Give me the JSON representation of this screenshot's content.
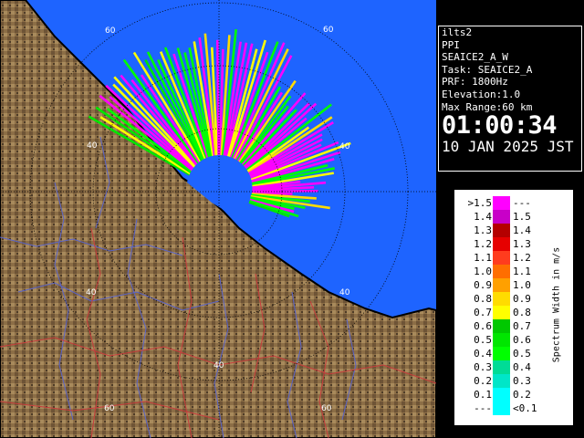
{
  "info": {
    "radar": "ilts2",
    "scan_type": "PPI",
    "product": "SEAICE2_A_W",
    "task": "Task: SEAICE2_A",
    "prf": "PRF: 1800Hz",
    "elevation": "Elevation:1.0",
    "max_range": "Max Range:60 km",
    "time": "01:00:34",
    "date": "10 JAN 2025 JST"
  },
  "legend": {
    "title": "Spectrum Width in m/s",
    "rows": [
      {
        "lo": ">1.5",
        "hi": "---",
        "color": "#ff00ff"
      },
      {
        "lo": "1.4",
        "hi": "1.5",
        "color": "#c800c8"
      },
      {
        "lo": "1.3",
        "hi": "1.4",
        "color": "#b40000"
      },
      {
        "lo": "1.2",
        "hi": "1.3",
        "color": "#e60000"
      },
      {
        "lo": "1.1",
        "hi": "1.2",
        "color": "#ff3c1e"
      },
      {
        "lo": "1.0",
        "hi": "1.1",
        "color": "#ff6e00"
      },
      {
        "lo": "0.9",
        "hi": "1.0",
        "color": "#ffa000"
      },
      {
        "lo": "0.8",
        "hi": "0.9",
        "color": "#ffdc00"
      },
      {
        "lo": "0.7",
        "hi": "0.8",
        "color": "#ffff00"
      },
      {
        "lo": "0.6",
        "hi": "0.7",
        "color": "#00c800"
      },
      {
        "lo": "0.5",
        "hi": "0.6",
        "color": "#00e600"
      },
      {
        "lo": "0.4",
        "hi": "0.5",
        "color": "#00ff00"
      },
      {
        "lo": "0.3",
        "hi": "0.4",
        "color": "#00dc96"
      },
      {
        "lo": "0.2",
        "hi": "0.3",
        "color": "#00e6c8"
      },
      {
        "lo": "0.1",
        "hi": "0.2",
        "color": "#00ffff"
      },
      {
        "lo": "---",
        "hi": "<0.1",
        "color": "#00ffff"
      }
    ]
  },
  "rings": {
    "labels": [
      "40",
      "60"
    ]
  },
  "colors": {
    "sea": "#1e64ff",
    "land": "#8c6e46",
    "coast": "#000000"
  }
}
